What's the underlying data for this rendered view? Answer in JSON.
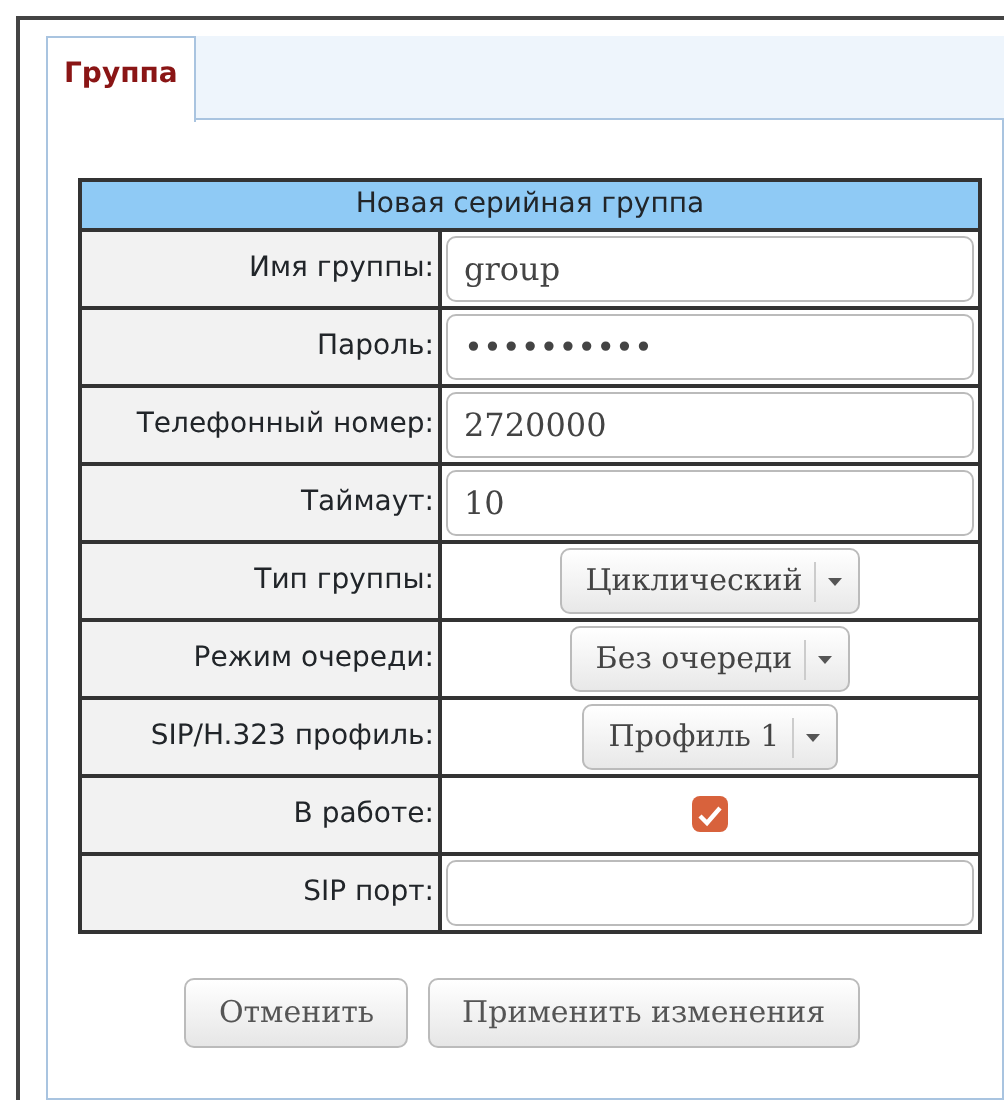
{
  "tabs": [
    {
      "label": "Группа",
      "selected": true
    }
  ],
  "form": {
    "title": "Новая серийная группа",
    "rows": [
      {
        "kind": "text",
        "label": "Имя группы:",
        "value": "group"
      },
      {
        "kind": "text",
        "label": "Пароль:",
        "value": "••••••••••"
      },
      {
        "kind": "text",
        "label": "Телефонный номер:",
        "value": "2720000"
      },
      {
        "kind": "text",
        "label": "Таймаут:",
        "value": "10"
      },
      {
        "kind": "select",
        "label": "Тип группы:",
        "value": "Циклический"
      },
      {
        "kind": "select",
        "label": "Режим очереди:",
        "value": "Без очереди"
      },
      {
        "kind": "select",
        "label": "SIP/H.323 профиль:",
        "value": "Профиль 1"
      },
      {
        "kind": "checkbox",
        "label": "В работе:",
        "checked": true
      },
      {
        "kind": "text",
        "label": "SIP порт:",
        "value": ""
      }
    ]
  },
  "buttons": [
    "Отменить",
    "Применить изменения"
  ]
}
